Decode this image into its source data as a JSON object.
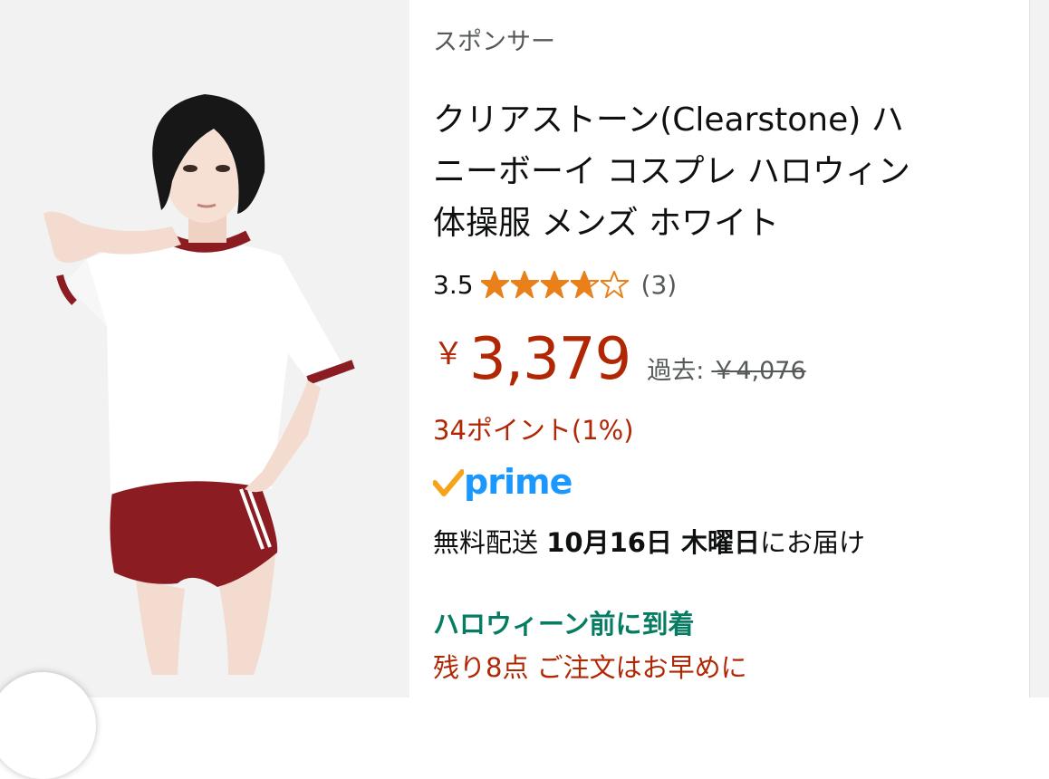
{
  "sponsored_label": "スポンサー",
  "product": {
    "title_lines": [
      "クリアストーン(Clearstone) ハ",
      "ニーボーイ コスプレ ハロウィン",
      "体操服 メンズ ホワイト"
    ],
    "image_alt": "model wearing white gym shirt with red trim and red shorts"
  },
  "rating": {
    "value": "3.5",
    "stars_fraction": 0.7,
    "review_count": "(3)"
  },
  "price": {
    "currency": "￥",
    "amount": "3,379",
    "past_label": "過去:",
    "past_price": "￥4,076"
  },
  "points": "34ポイント(1%)",
  "prime_label": "prime",
  "delivery": {
    "prefix": "無料配送 ",
    "date": "10月16日 木曜日",
    "suffix": "にお届け"
  },
  "badge_halloween": "ハロウィーン前に到着",
  "stock_notice": "残り8点 ご注文はお早めに",
  "colors": {
    "price": "#b12704",
    "prime_blue": "#1a98ff",
    "prime_check": "#f7a21b",
    "star": "#e9801a",
    "deal_green": "#067d62"
  }
}
